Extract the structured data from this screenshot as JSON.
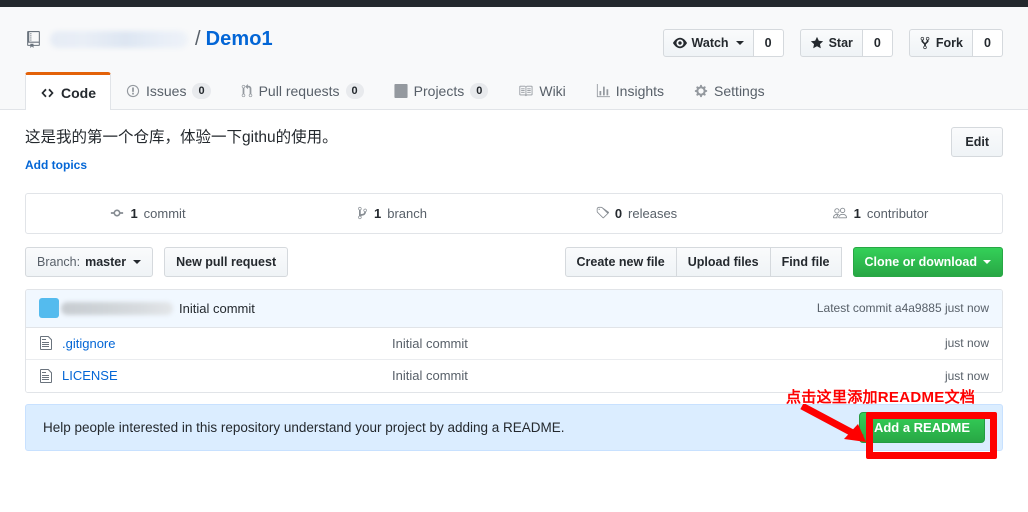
{
  "repo": {
    "owner_redacted": true,
    "separator": "/",
    "name": "Demo1"
  },
  "header_actions": [
    {
      "label": "Watch",
      "count": "0",
      "icon": "eye-icon",
      "has_caret": true
    },
    {
      "label": "Star",
      "count": "0",
      "icon": "star-icon",
      "has_caret": false
    },
    {
      "label": "Fork",
      "count": "0",
      "icon": "fork-icon",
      "has_caret": false
    }
  ],
  "tabs": [
    {
      "label": "Code",
      "icon": "code-icon",
      "count": null,
      "active": true
    },
    {
      "label": "Issues",
      "icon": "issue-opened-icon",
      "count": "0",
      "active": false
    },
    {
      "label": "Pull requests",
      "icon": "git-pull-request-icon",
      "count": "0",
      "active": false
    },
    {
      "label": "Projects",
      "icon": "project-board-icon",
      "count": "0",
      "active": false
    },
    {
      "label": "Wiki",
      "icon": "book-icon",
      "count": null,
      "active": false
    },
    {
      "label": "Insights",
      "icon": "graph-icon",
      "count": null,
      "active": false
    },
    {
      "label": "Settings",
      "icon": "gear-icon",
      "count": null,
      "active": false
    }
  ],
  "description": {
    "text": "这是我的第一个仓库，体验一下githu的使用。",
    "add_topics_label": "Add topics",
    "edit_label": "Edit"
  },
  "stats": [
    {
      "icon": "commit-icon",
      "value": "1",
      "label": "commit"
    },
    {
      "icon": "branch-icon",
      "value": "1",
      "label": "branch"
    },
    {
      "icon": "tag-icon",
      "value": "0",
      "label": "releases"
    },
    {
      "icon": "people-icon",
      "value": "1",
      "label": "contributor"
    }
  ],
  "toolbar": {
    "branch_prefix": "Branch:",
    "branch_name": "master",
    "new_pull_request": "New pull request",
    "create_new_file": "Create new file",
    "upload_files": "Upload files",
    "find_file": "Find file",
    "clone_or_download": "Clone or download"
  },
  "commit_bar": {
    "message": "Initial commit",
    "latest_prefix": "Latest commit",
    "sha": "a4a9885",
    "age": "just now"
  },
  "files": [
    {
      "icon": "file-icon",
      "name": ".gitignore",
      "message": "Initial commit",
      "age": "just now"
    },
    {
      "icon": "file-icon",
      "name": "LICENSE",
      "message": "Initial commit",
      "age": "just now"
    }
  ],
  "readme_callout": {
    "text": "Help people interested in this repository understand your project by adding a README.",
    "button_label": "Add a README"
  },
  "annotation": {
    "text": "点击这里添加README文档",
    "color": "#fe0000",
    "target": "add-a-readme-button"
  },
  "colors": {
    "link_blue": "#0366d6",
    "green": "#28a745",
    "active_tab_orange": "#e36209",
    "callout_bg": "#dbedff",
    "topbar_dark": "#24292e"
  }
}
